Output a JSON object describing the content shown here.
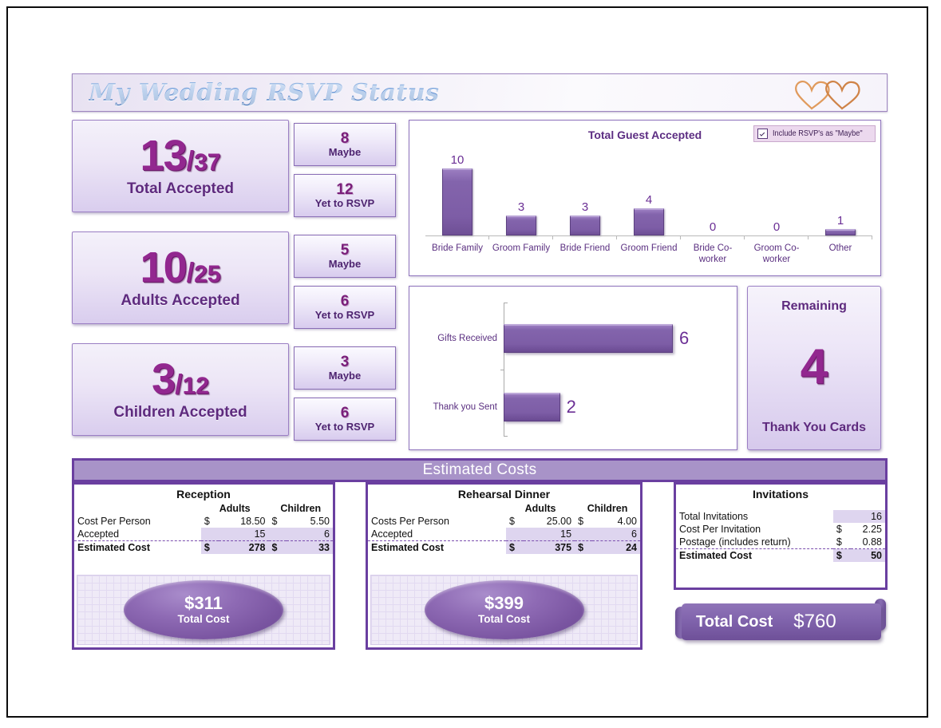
{
  "header": {
    "title": "My Wedding RSVP Status",
    "logo_icon": "interlocking-hearts-icon"
  },
  "kpis": [
    {
      "numerator": "13",
      "slash": "/",
      "denominator": "37",
      "label": "Total Accepted"
    },
    {
      "numerator": "10",
      "slash": "/",
      "denominator": "25",
      "label": "Adults Accepted"
    },
    {
      "numerator": "3",
      "slash": "/",
      "denominator": "12",
      "label": "Children Accepted"
    }
  ],
  "side_boxes": [
    {
      "value": "8",
      "label": "Maybe"
    },
    {
      "value": "12",
      "label": "Yet to RSVP"
    },
    {
      "value": "5",
      "label": "Maybe"
    },
    {
      "value": "6",
      "label": "Yet to RSVP"
    },
    {
      "value": "3",
      "label": "Maybe"
    },
    {
      "value": "6",
      "label": "Yet to RSVP"
    }
  ],
  "guest_chart": {
    "checkbox_label": "Include RSVP's as \"Maybe\"",
    "checkbox_checked": "true"
  },
  "remaining": {
    "top_label": "Remaining",
    "value": "4",
    "bottom_label": "Thank You Cards"
  },
  "estimated_costs": {
    "section_title": "Estimated Costs",
    "reception": {
      "title": "Reception",
      "col_adults": "Adults",
      "col_children": "Children",
      "rows": [
        {
          "label": "Cost Per Person",
          "adult_cur": "$",
          "adult_val": "18.50",
          "child_cur": "$",
          "child_val": "5.50"
        },
        {
          "label": "Accepted",
          "adult_cur": "",
          "adult_val": "15",
          "child_cur": "",
          "child_val": "6"
        },
        {
          "label": "Estimated Cost",
          "adult_cur": "$",
          "adult_val": "278",
          "child_cur": "$",
          "child_val": "33"
        }
      ],
      "total_value": "$311",
      "total_label": "Total Cost"
    },
    "rehearsal": {
      "title": "Rehearsal Dinner",
      "col_adults": "Adults",
      "col_children": "Children",
      "rows": [
        {
          "label": "Costs Per Person",
          "adult_cur": "$",
          "adult_val": "25.00",
          "child_cur": "$",
          "child_val": "4.00"
        },
        {
          "label": "Accepted",
          "adult_cur": "",
          "adult_val": "15",
          "child_cur": "",
          "child_val": "6"
        },
        {
          "label": "Estimated Cost",
          "adult_cur": "$",
          "adult_val": "375",
          "child_cur": "$",
          "child_val": "24"
        }
      ],
      "total_value": "$399",
      "total_label": "Total Cost"
    },
    "invitations": {
      "title": "Invitations",
      "rows": [
        {
          "label": "Total Invitations",
          "cur": "",
          "val": "16"
        },
        {
          "label": "Cost Per Invitation",
          "cur": "$",
          "val": "2.25"
        },
        {
          "label": "Postage (includes return)",
          "cur": "$",
          "val": "0.88"
        },
        {
          "label": "Estimated Cost",
          "cur": "$",
          "val": "50"
        }
      ]
    },
    "grand_total": {
      "label": "Total Cost",
      "value": "$760"
    }
  },
  "chart_data": [
    {
      "type": "bar",
      "title": "Total Guest Accepted",
      "categories": [
        "Bride Family",
        "Groom Family",
        "Bride Friend",
        "Groom Friend",
        "Bride Co-worker",
        "Groom Co-worker",
        "Other"
      ],
      "values": [
        10,
        3,
        3,
        4,
        0,
        0,
        1
      ],
      "xlabel": "",
      "ylabel": "",
      "ylim": [
        0,
        10
      ],
      "grid": false,
      "legend": "none",
      "data_labels": true,
      "bar_color": "#7d5da6"
    },
    {
      "type": "bar",
      "orientation": "horizontal",
      "title": "",
      "categories": [
        "Gifts Received",
        "Thank you Sent"
      ],
      "values": [
        6,
        2
      ],
      "xlabel": "",
      "ylabel": "",
      "xlim": [
        0,
        6
      ],
      "grid": false,
      "legend": "none",
      "data_labels": true,
      "bar_color": "#7d5da6"
    }
  ],
  "colors": {
    "accent_purple": "#6a3fa0",
    "bar_purple": "#7d5da6",
    "kpi_number": "#92278f",
    "title_blue": "#2f63ad",
    "hearts_orange": "#d98a4f"
  }
}
